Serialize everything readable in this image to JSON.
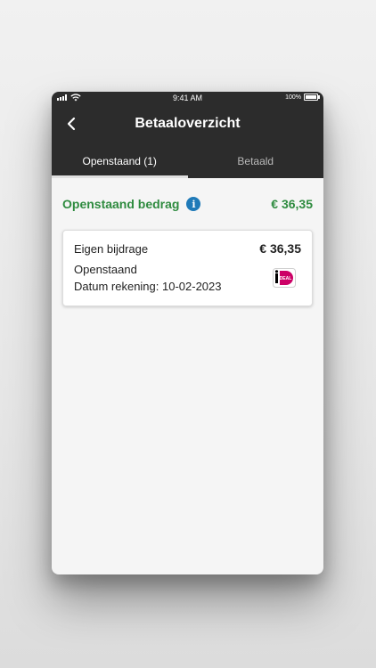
{
  "statusbar": {
    "time": "9:41 AM",
    "battery": "100%"
  },
  "navbar": {
    "title": "Betaaloverzicht"
  },
  "tabs": [
    {
      "label": "Openstaand (1)",
      "active": true
    },
    {
      "label": "Betaald",
      "active": false
    }
  ],
  "summary": {
    "title": "Openstaand bedrag",
    "amount": "€ 36,35"
  },
  "card": {
    "label": "Eigen bijdrage",
    "amount": "€ 36,35",
    "status": "Openstaand",
    "date": "Datum rekening: 10-02-2023",
    "payment_logo_text": "iDEAL"
  },
  "colors": {
    "header": "#2c2c2c",
    "accent_green": "#2e8b3f",
    "info_blue": "#1f7ab8",
    "ideal_pink": "#cc0066"
  },
  "icons": {
    "back": "chevron-left-icon",
    "info": "info-icon",
    "payment": "ideal-logo-icon"
  }
}
